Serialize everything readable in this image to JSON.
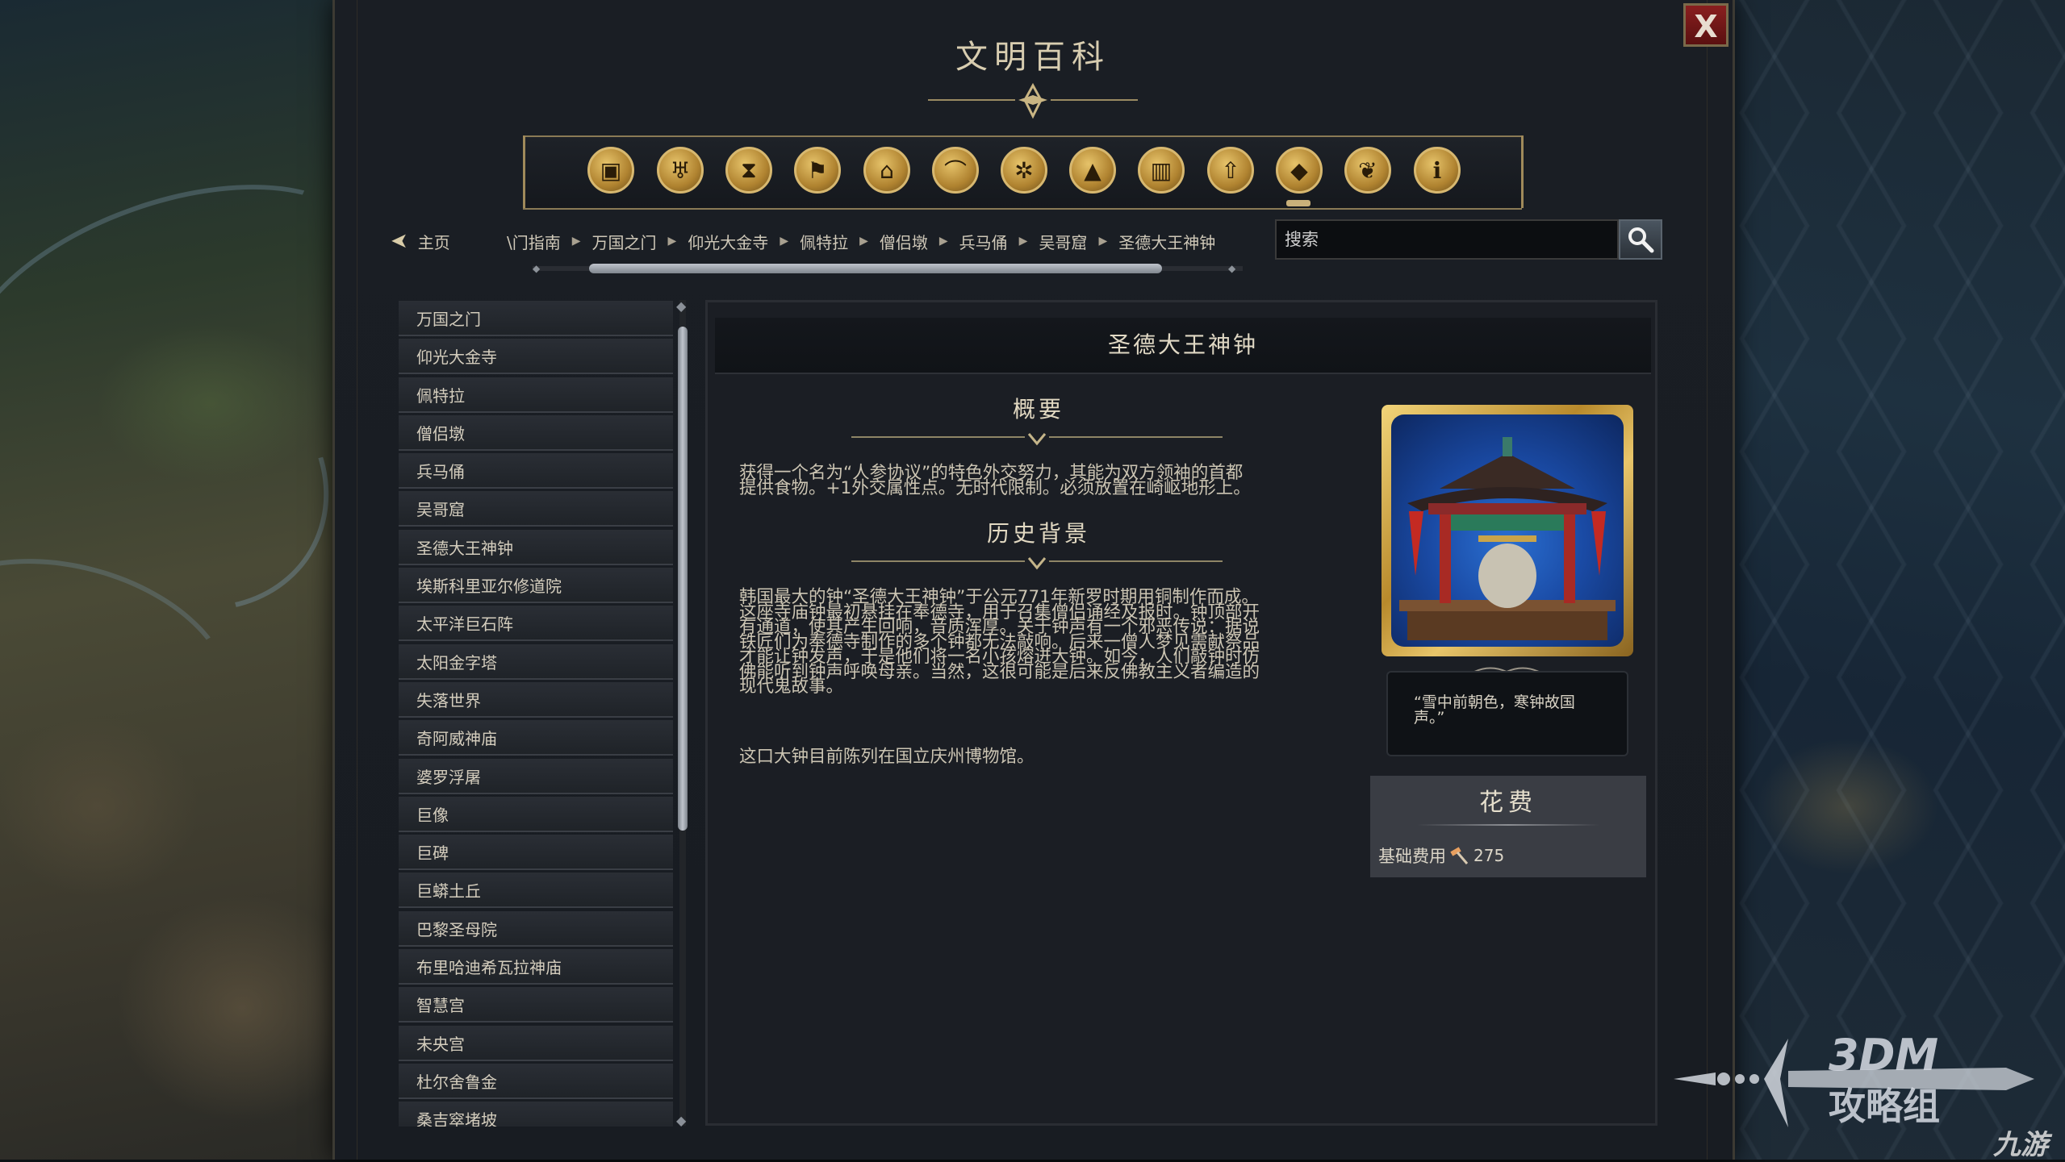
{
  "window": {
    "title": "文明百科",
    "close_label": "X"
  },
  "categories": [
    {
      "icon": "wonders-box-icon"
    },
    {
      "icon": "goblet-icon"
    },
    {
      "icon": "hourglass-icon"
    },
    {
      "icon": "flag-icon"
    },
    {
      "icon": "temple-icon"
    },
    {
      "icon": "landscape-icon"
    },
    {
      "icon": "atom-icon"
    },
    {
      "icon": "mountain-icon"
    },
    {
      "icon": "city-icon"
    },
    {
      "icon": "arrow-up-icon"
    },
    {
      "icon": "pyramid-icon"
    },
    {
      "icon": "dove-icon"
    },
    {
      "icon": "info-icon"
    }
  ],
  "nav": {
    "home_label": "主页",
    "breadcrumbs": [
      "\\门指南",
      "万国之门",
      "仰光大金寺",
      "佩特拉",
      "僧侣墩",
      "兵马俑",
      "吴哥窟",
      "圣德大王神钟"
    ],
    "search_placeholder": "搜索"
  },
  "list": [
    "万国之门",
    "仰光大金寺",
    "佩特拉",
    "僧侣墩",
    "兵马俑",
    "吴哥窟",
    "圣德大王神钟",
    "埃斯科里亚尔修道院",
    "太平洋巨石阵",
    "太阳金字塔",
    "失落世界",
    "奇阿威神庙",
    "婆罗浮屠",
    "巨像",
    "巨碑",
    "巨蟒土丘",
    "巴黎圣母院",
    "布里哈迪希瓦拉神庙",
    "智慧宫",
    "未央宫",
    "杜尔舍鲁金",
    "桑吉窣堵坡"
  ],
  "article": {
    "title": "圣德大王神钟",
    "overview_heading": "概要",
    "overview_lines": [
      "获得一个名为“人参协议”的特色外交努力，其能为双方领袖的首都",
      "提供食物。+1外交属性点。无时代限制。必须放置在崎岖地形上。"
    ],
    "history_heading": "历史背景",
    "history_lines": [
      "韩国最大的钟“圣德大王神钟”于公元771年新罗时期用铜制作而成。",
      "这座寺庙钟最初悬挂在奉德寺，用于召集僧侣诵经及报时。钟顶部开",
      "有通道，使其产生回响，音质浑厚。关于钟声有一个邪恶传说：据说",
      "铁匠们为奉德寺制作的多个钟都无法敲响。后来一僧人梦见需献祭品",
      "才能让钟发声，于是他们将一名小孩熔进大钟。如今，人们敲钟时仿",
      "佛能听到钟声呼唤母亲。当然，这很可能是后来反佛教主义者编造的",
      "现代鬼故事。"
    ],
    "history_extra": "这口大钟目前陈列在国立庆州博物馆。",
    "quote_lines": [
      "“雪中前朝色，寒钟故国",
      "声。”"
    ],
    "cost_heading": "花费",
    "cost_label": "基础费用",
    "cost_icon": "hammer-icon",
    "cost_value": "275"
  },
  "watermark": {
    "line1": "3DM",
    "line2": "攻略组",
    "line3": "九游"
  }
}
